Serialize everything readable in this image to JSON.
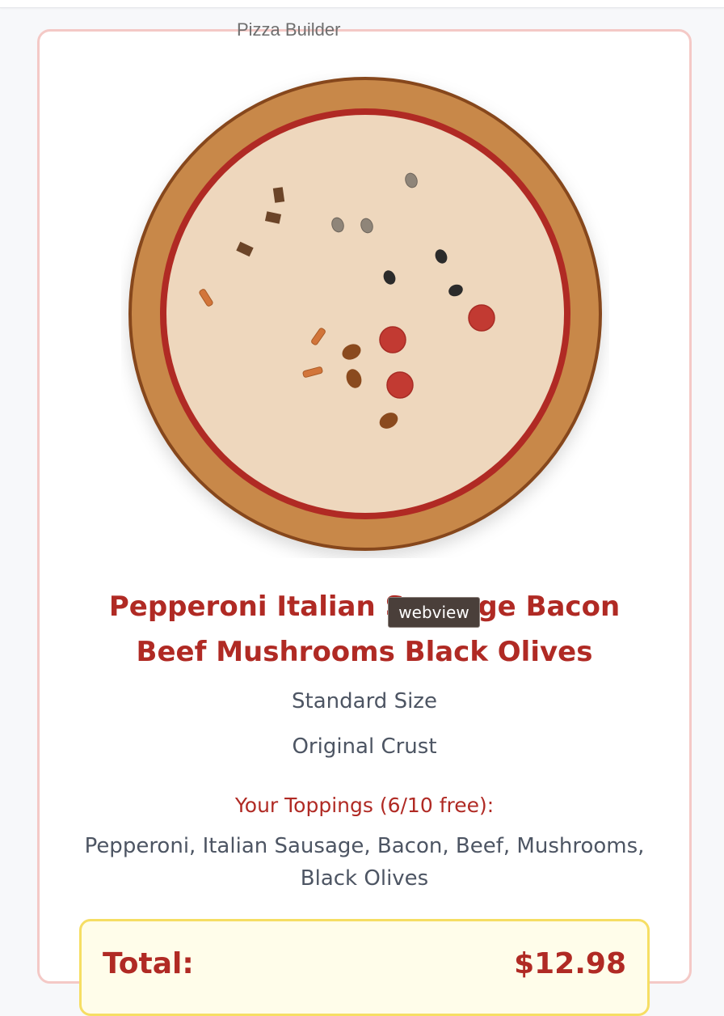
{
  "pizza_image": {
    "alt_label": "Pizza Builder",
    "colors": {
      "crust": "#c8884a",
      "crust_edge": "#86471c",
      "sauce": "#b02a24",
      "cheese": "#eed7bd",
      "pepperoni": "#c23a32",
      "sausage": "#d2753a",
      "bacon": "#6b4428",
      "beef": "#8a4a1e",
      "mushroom": "#8f8579",
      "olive": "#2b2b2b"
    }
  },
  "tooltip": {
    "text": "webview"
  },
  "summary": {
    "pizza_name": "Pepperoni Italian Sausage Bacon Beef Mushrooms Black Olives",
    "size": "Standard Size",
    "crust": "Original Crust",
    "toppings_heading": "Your Toppings (6/10 free):",
    "toppings_list": "Pepperoni, Italian Sausage, Bacon, Beef, Mushrooms, Black Olives"
  },
  "total": {
    "label": "Total:",
    "value": "$12.98"
  }
}
